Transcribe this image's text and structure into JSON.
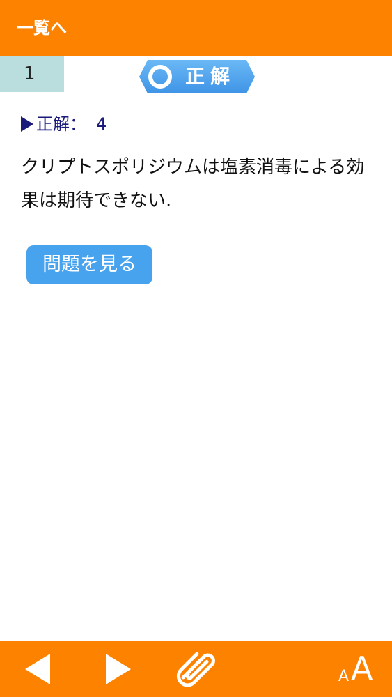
{
  "header": {
    "back_label": "一覧へ"
  },
  "question": {
    "number": "1",
    "result_label": "正解"
  },
  "answer": {
    "prefix": "正解：",
    "value": "4"
  },
  "explanation": {
    "text": "クリプトスポリジウムは塩素消毒による効果は期待できない."
  },
  "actions": {
    "view_question_label": "問題を見る"
  },
  "toolbar": {
    "font_small_label": "A",
    "font_big_label": "A"
  },
  "colors": {
    "header_bg": "#fd8200",
    "badge_blue": "#48a3ef",
    "number_bg": "#b9dedd",
    "answer_text": "#1a1a7a"
  },
  "icons": {
    "prev": "triangle-left-icon",
    "next": "triangle-right-icon",
    "attach": "paperclip-icon",
    "result": "circle-correct-icon"
  }
}
